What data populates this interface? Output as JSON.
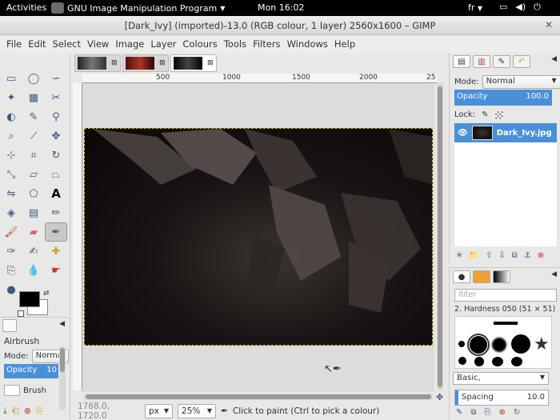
{
  "topbar": {
    "activities": "Activities",
    "app_name": "GNU Image Manipulation Program",
    "clock": "Mon 16:02",
    "lang": "fr"
  },
  "window": {
    "title": "[Dark_Ivy] (imported)-13.0 (RGB colour, 1 layer) 2560x1600 – GIMP"
  },
  "menu": [
    "File",
    "Edit",
    "Select",
    "View",
    "Image",
    "Layer",
    "Colours",
    "Tools",
    "Filters",
    "Windows",
    "Help"
  ],
  "ruler": {
    "h": [
      "500",
      "1000",
      "1500",
      "2000",
      "25"
    ]
  },
  "tool_options": {
    "tool": "Airbrush",
    "mode_label": "Mode:",
    "mode_value": "Normal",
    "opacity_label": "Opacity",
    "opacity_value": "10",
    "brush_label": "Brush"
  },
  "statusbar": {
    "coords": "1768.0, 1720.0",
    "unit": "px",
    "zoom": "25%",
    "message": "Click to paint (Ctrl to pick a colour)"
  },
  "layers": {
    "mode_label": "Mode:",
    "mode_value": "Normal",
    "opacity_label": "Opacity",
    "opacity_value": "100.0",
    "lock_label": "Lock:",
    "layer_name": "Dark_Ivy.jpg"
  },
  "brushes": {
    "filter_placeholder": "filter",
    "selected": "2. Hardness 050 (51 × 51)",
    "tag": "Basic,",
    "spacing_label": "Spacing",
    "spacing_value": "10.0"
  },
  "colors": {
    "accent": "#4a90d9",
    "fg": "#000000",
    "bg": "#ffffff"
  }
}
